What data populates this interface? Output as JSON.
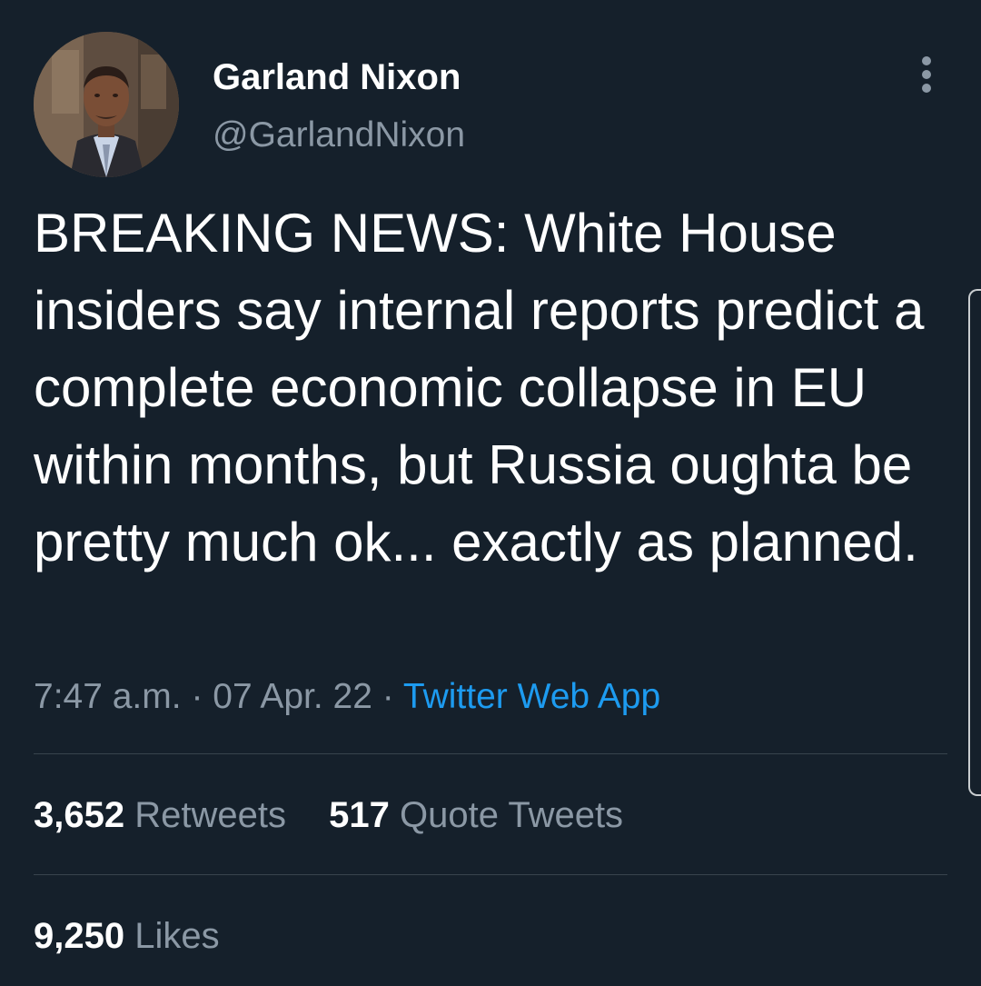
{
  "colors": {
    "background": "#15202b",
    "primary_text": "#ffffff",
    "secondary_text": "#8b98a5",
    "accent": "#1d9bf0",
    "divider": "#38444d"
  },
  "author": {
    "display_name": "Garland Nixon",
    "handle": "@GarlandNixon",
    "avatar_icon": "profile-photo"
  },
  "tweet": {
    "text": "BREAKING NEWS: White House insiders say internal reports predict a complete economic collapse in EU within months, but Russia oughta be pretty much ok... exactly as planned.",
    "time": "7:47 a.m.",
    "date": "07 Apr. 22",
    "separator": "·",
    "source": "Twitter Web App"
  },
  "stats": {
    "retweets_count": "3,652",
    "retweets_label": "Retweets",
    "quote_tweets_count": "517",
    "quote_tweets_label": "Quote Tweets",
    "likes_count": "9,250",
    "likes_label": "Likes"
  },
  "icons": {
    "more": "more-vertical-icon"
  }
}
